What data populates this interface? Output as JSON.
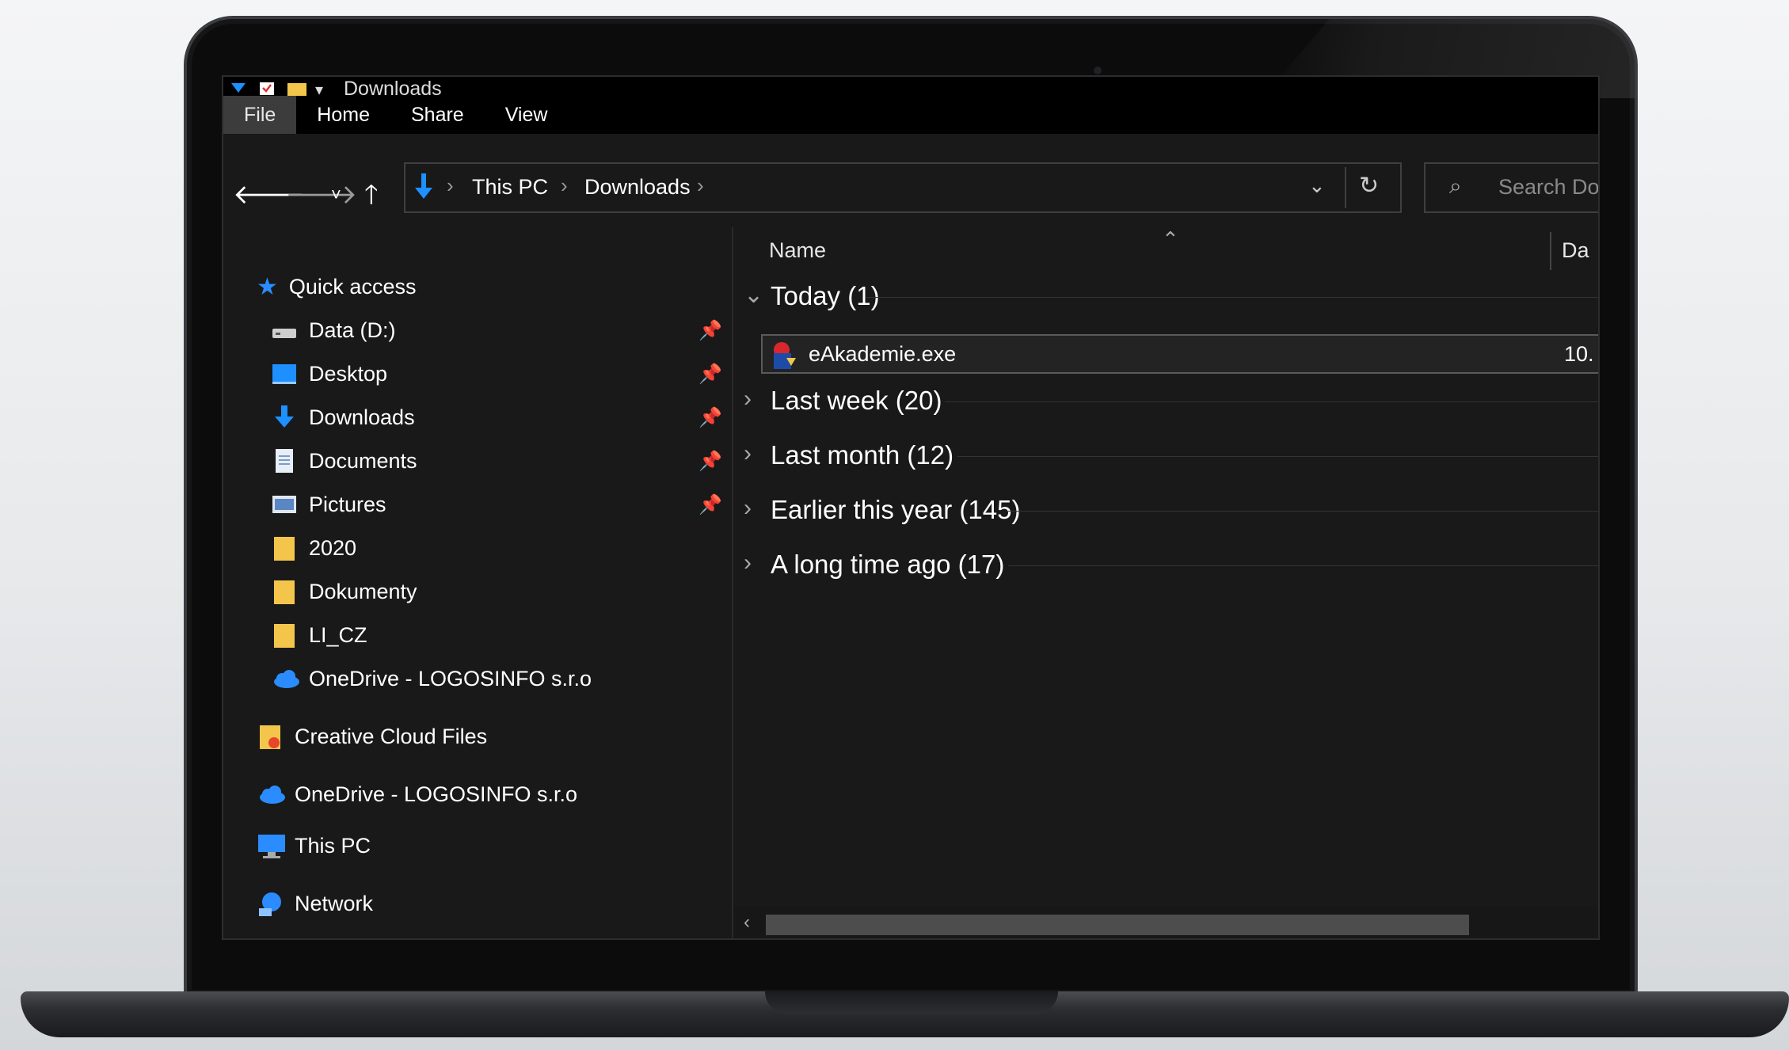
{
  "window": {
    "title": "Downloads"
  },
  "ribbon": {
    "tabs": [
      "File",
      "Home",
      "Share",
      "View"
    ]
  },
  "address": {
    "crumbs": [
      "This PC",
      "Downloads"
    ],
    "search_placeholder": "Search Dow"
  },
  "nav": {
    "quick_access": "Quick access",
    "items": [
      {
        "label": "Data (D:)",
        "icon": "drive-icon",
        "pinned": true
      },
      {
        "label": "Desktop",
        "icon": "desktop-icon",
        "pinned": true
      },
      {
        "label": "Downloads",
        "icon": "download-icon",
        "pinned": true
      },
      {
        "label": "Documents",
        "icon": "document-icon",
        "pinned": true
      },
      {
        "label": "Pictures",
        "icon": "pictures-icon",
        "pinned": true
      },
      {
        "label": "2020",
        "icon": "folder-icon",
        "pinned": false
      },
      {
        "label": "Dokumenty",
        "icon": "folder-icon",
        "pinned": false
      },
      {
        "label": "LI_CZ",
        "icon": "folder-icon",
        "pinned": false
      },
      {
        "label": "OneDrive - LOGOSINFO s.r.o",
        "icon": "cloud-icon",
        "pinned": false
      }
    ],
    "creative_cloud": "Creative Cloud Files",
    "onedrive": "OneDrive - LOGOSINFO s.r.o",
    "this_pc": "This PC",
    "network": "Network"
  },
  "content": {
    "columns": {
      "name": "Name",
      "date": "Da"
    },
    "groups": [
      {
        "label": "Today (1)",
        "expanded": true
      },
      {
        "label": "Last week (20)",
        "expanded": false
      },
      {
        "label": "Last month (12)",
        "expanded": false
      },
      {
        "label": "Earlier this year (145)",
        "expanded": false
      },
      {
        "label": "A long time ago (17)",
        "expanded": false
      }
    ],
    "file": {
      "name": "eAkademie.exe",
      "date": "10."
    }
  },
  "colors": {
    "accent": "#1e90ff",
    "folder": "#f3c64b",
    "background": "#191919"
  }
}
